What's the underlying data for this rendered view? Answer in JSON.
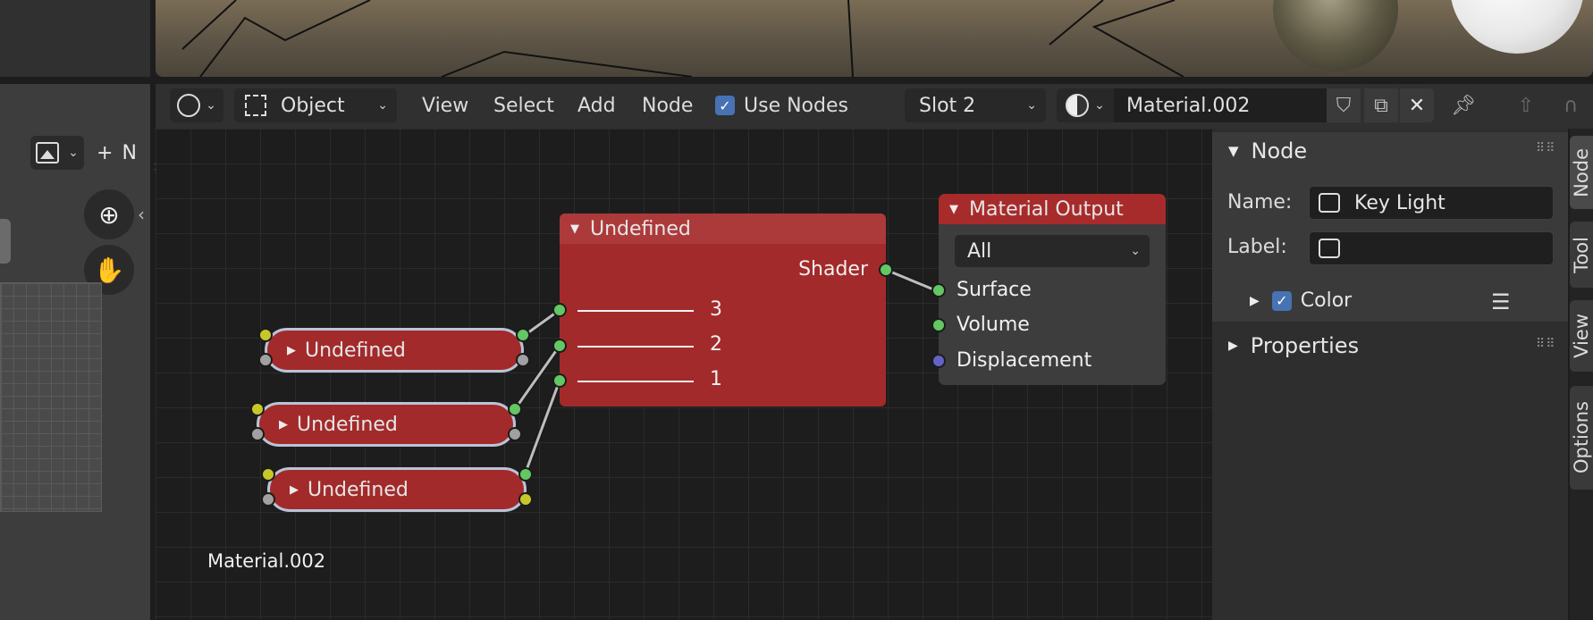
{
  "header": {
    "editor_type_icon": "node-editor-icon",
    "mode_label": "Object",
    "menus": [
      "View",
      "Select",
      "Add",
      "Node"
    ],
    "use_nodes_label": "Use Nodes",
    "use_nodes_checked": true,
    "slot_label": "Slot 2",
    "material_name": "Material.002"
  },
  "left_panel": {
    "new_label": "N"
  },
  "nodes": {
    "mix_title": "Undefined",
    "mix_output": "Shader",
    "mix_inputs": [
      "3",
      "2",
      "1"
    ],
    "group1": "Undefined",
    "group2": "Undefined",
    "group3": "Undefined",
    "output_title": "Material Output",
    "output_target": "All",
    "output_inputs": [
      "Surface",
      "Volume",
      "Displacement"
    ]
  },
  "editor_footer_label": "Material.002",
  "sidebar": {
    "node_panel_title": "Node",
    "name_label": "Name:",
    "name_value": "Key Light",
    "label_label": "Label:",
    "label_value": "",
    "color_label": "Color",
    "properties_title": "Properties",
    "tabs": [
      "Node",
      "Tool",
      "View",
      "Options"
    ]
  },
  "colors": {
    "node_red": "#a32a2a",
    "socket_shader": "#63c763",
    "socket_color": "#c7c729",
    "socket_vector": "#6363c7",
    "accent_blue": "#4772b3"
  }
}
